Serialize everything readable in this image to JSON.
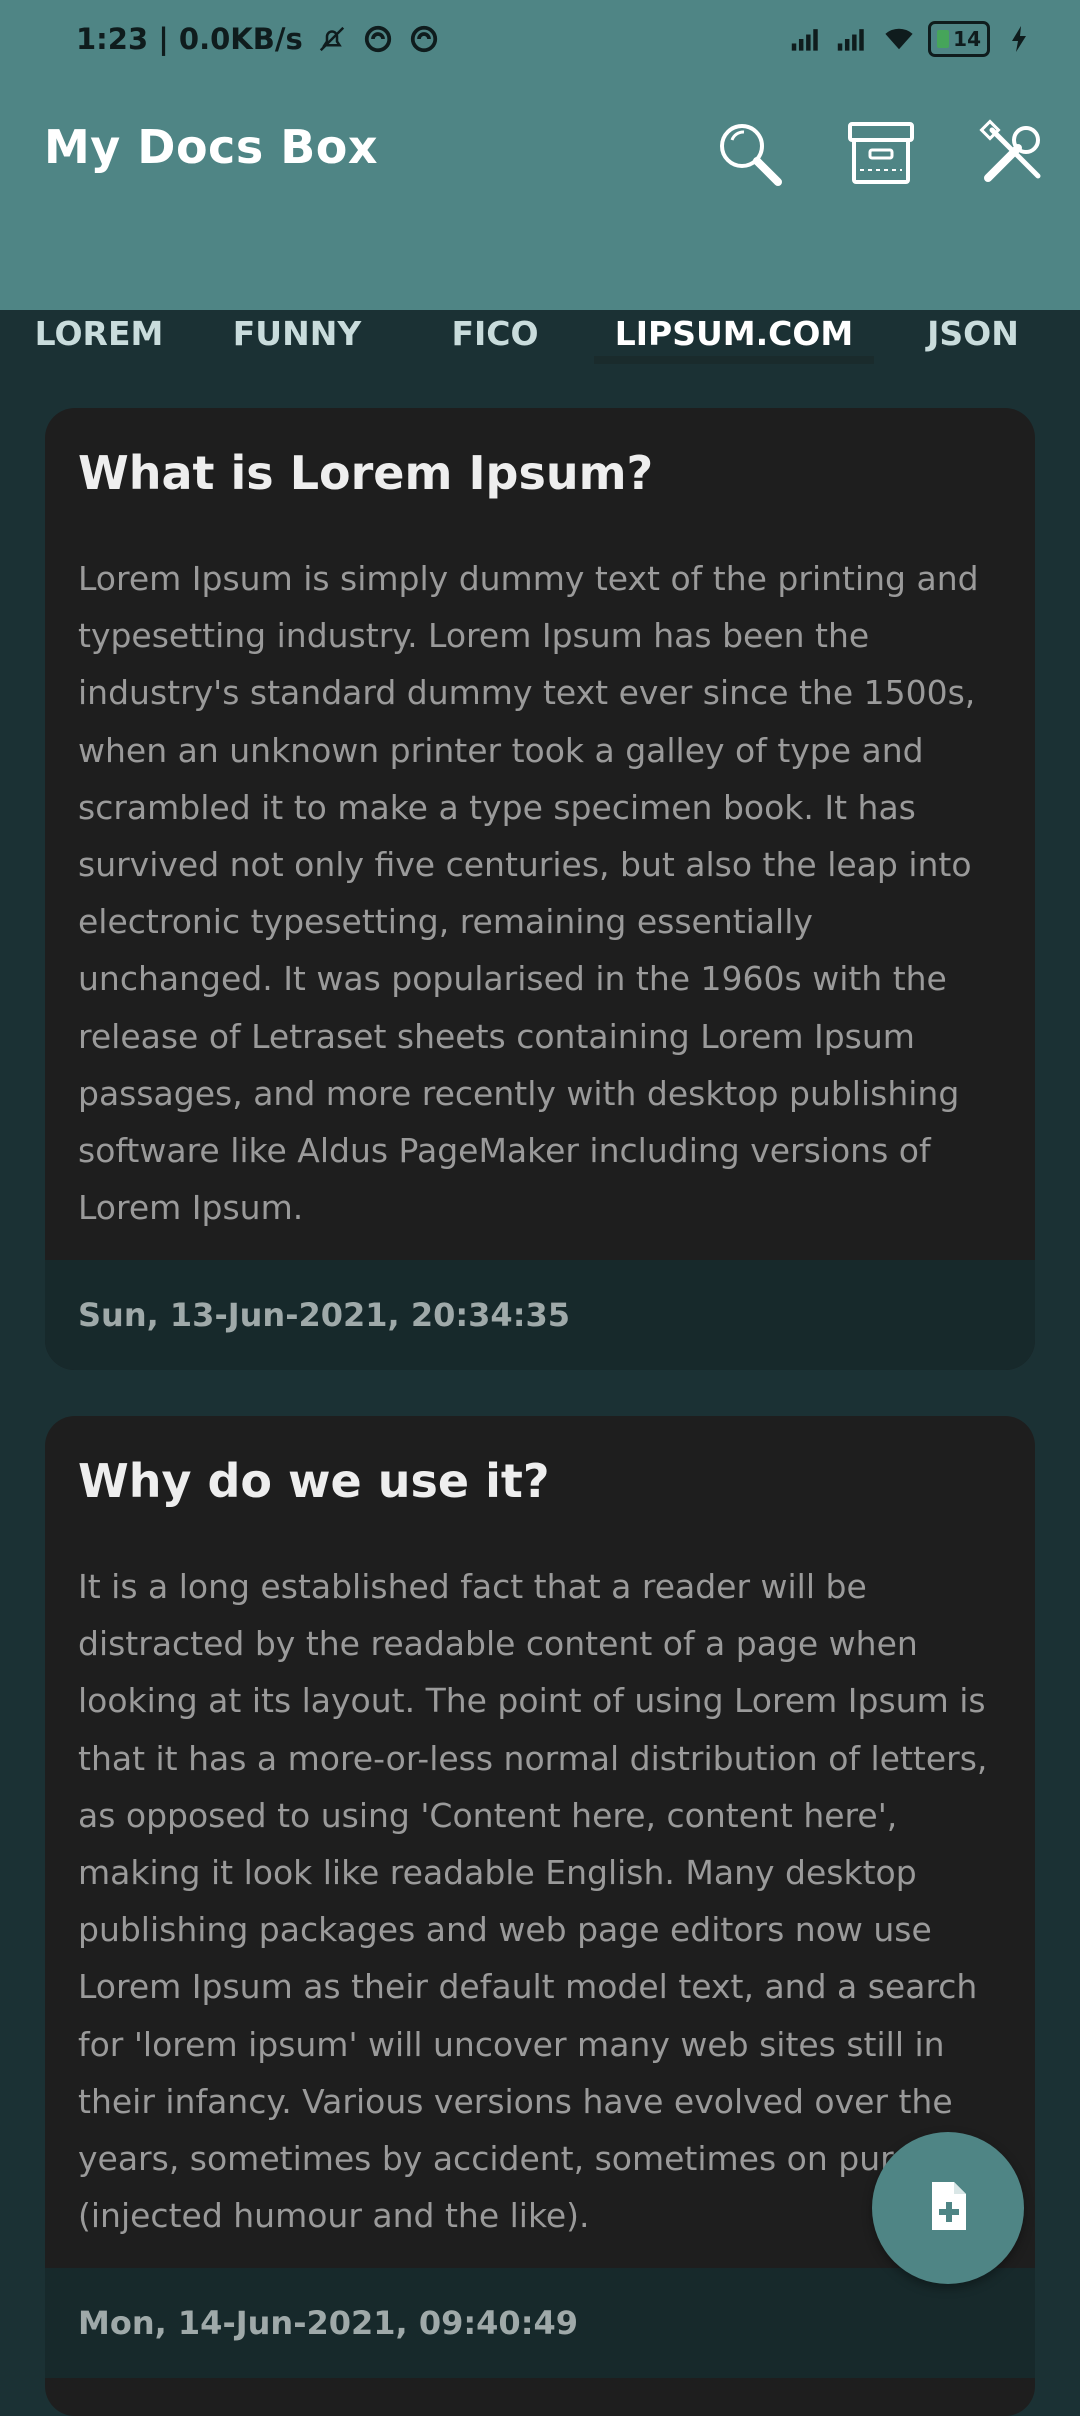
{
  "status_bar": {
    "time_speed": "1:23 | 0.0KB/s",
    "battery": "14"
  },
  "app": {
    "title": "My Docs Box"
  },
  "tabs": [
    {
      "label": "LOREM"
    },
    {
      "label": "FUNNY"
    },
    {
      "label": "FICO"
    },
    {
      "label": "LIPSUM.COM"
    },
    {
      "label": "JSON"
    }
  ],
  "active_tab": "LIPSUM.COM",
  "cards": [
    {
      "title": "What is Lorem Ipsum?",
      "body": "Lorem Ipsum is simply dummy text of the printing and typesetting industry. Lorem Ipsum has been the industry's standard dummy text ever since the 1500s, when an unknown printer took a galley of type and scrambled it to make a type specimen book. It has survived not only five centuries, but also the leap into electronic typesetting, remaining essentially unchanged. It was popularised in the 1960s with the release of Letraset sheets containing Lorem Ipsum passages, and more recently with desktop publishing software like Aldus PageMaker including versions of Lorem Ipsum.",
      "date": "Sun, 13-Jun-2021, 20:34:35"
    },
    {
      "title": "Why do we use it?",
      "body": "It is a long established fact that a reader will be distracted by the readable content of a page when looking at its layout. The point of using Lorem Ipsum is that it has a more-or-less normal distribution of letters, as opposed to using 'Content here, content here', making it look like readable English. Many desktop publishing packages and web page editors now use Lorem Ipsum as their default model text, and a search for 'lorem ipsum' will uncover many web sites still in their infancy. Various versions have evolved over the years, sometimes by accident, sometimes on purpose (injected humour and the like).",
      "date": "Mon, 14-Jun-2021, 09:40:49"
    }
  ],
  "icons": {
    "search": "search-icon",
    "archive": "archive-icon",
    "settings": "tools-icon",
    "add": "add-document-icon"
  },
  "colors": {
    "primary": "#4f8585",
    "background": "#1b3134",
    "card": "#1e1e1e"
  }
}
